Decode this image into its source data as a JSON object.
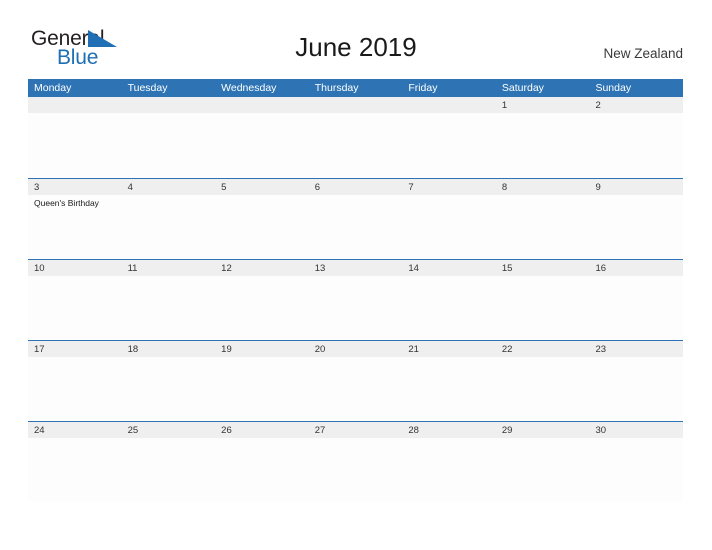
{
  "brand": {
    "name_part1": "General",
    "name_part2": "Blue",
    "flag_color": "#1f6fb5",
    "text_color": "#231f20"
  },
  "header": {
    "title": "June 2019",
    "country": "New Zealand"
  },
  "colors": {
    "header_blue": "#2e74b5",
    "date_band_gray": "#efefef",
    "date_text": "#333333"
  },
  "calendar": {
    "weekdays": [
      "Monday",
      "Tuesday",
      "Wednesday",
      "Thursday",
      "Friday",
      "Saturday",
      "Sunday"
    ],
    "weeks": [
      {
        "days": [
          {
            "num": "",
            "events": []
          },
          {
            "num": "",
            "events": []
          },
          {
            "num": "",
            "events": []
          },
          {
            "num": "",
            "events": []
          },
          {
            "num": "",
            "events": []
          },
          {
            "num": "1",
            "events": []
          },
          {
            "num": "2",
            "events": []
          }
        ]
      },
      {
        "days": [
          {
            "num": "3",
            "events": [
              "Queen's Birthday"
            ]
          },
          {
            "num": "4",
            "events": []
          },
          {
            "num": "5",
            "events": []
          },
          {
            "num": "6",
            "events": []
          },
          {
            "num": "7",
            "events": []
          },
          {
            "num": "8",
            "events": []
          },
          {
            "num": "9",
            "events": []
          }
        ]
      },
      {
        "days": [
          {
            "num": "10",
            "events": []
          },
          {
            "num": "11",
            "events": []
          },
          {
            "num": "12",
            "events": []
          },
          {
            "num": "13",
            "events": []
          },
          {
            "num": "14",
            "events": []
          },
          {
            "num": "15",
            "events": []
          },
          {
            "num": "16",
            "events": []
          }
        ]
      },
      {
        "days": [
          {
            "num": "17",
            "events": []
          },
          {
            "num": "18",
            "events": []
          },
          {
            "num": "19",
            "events": []
          },
          {
            "num": "20",
            "events": []
          },
          {
            "num": "21",
            "events": []
          },
          {
            "num": "22",
            "events": []
          },
          {
            "num": "23",
            "events": []
          }
        ]
      },
      {
        "days": [
          {
            "num": "24",
            "events": []
          },
          {
            "num": "25",
            "events": []
          },
          {
            "num": "26",
            "events": []
          },
          {
            "num": "27",
            "events": []
          },
          {
            "num": "28",
            "events": []
          },
          {
            "num": "29",
            "events": []
          },
          {
            "num": "30",
            "events": []
          }
        ]
      }
    ]
  }
}
